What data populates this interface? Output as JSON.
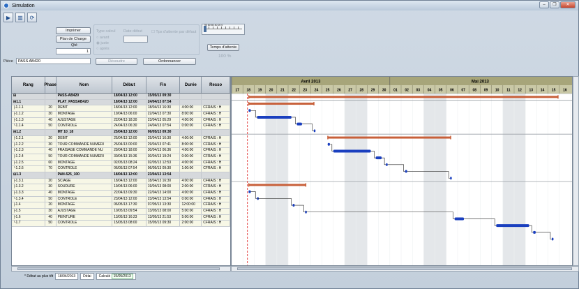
{
  "window": {
    "title": "Simulation",
    "controls": [
      "–",
      "❐",
      "✕"
    ]
  },
  "toolbar": [
    {
      "name": "play-icon",
      "glyph": "▶"
    },
    {
      "name": "chart-icon",
      "glyph": "▥"
    },
    {
      "name": "refresh-icon",
      "glyph": "⟳"
    }
  ],
  "form": {
    "imprimer": "Imprimer",
    "plan_de_charge": "Plan de Charge",
    "qte_label": "Qté",
    "qte_value": "1",
    "piece_label": "Pièce",
    "piece_value": "PASS AB420",
    "type_calcul": "Type calcul",
    "option_avant": "avant",
    "option_juste": "juste",
    "option_apres": "après",
    "date_label": "Date début",
    "tps_attente_defaut": "Tps d'attente par défaut",
    "temps_attente": "Temps d'attente",
    "slider_scale": "90 80 60 40 20 0",
    "percent": "100 %",
    "resoudre": "Résoudre",
    "ordonnancer": "Ordonnancer"
  },
  "table": {
    "headers": [
      "Rang",
      "Phase",
      "Nom",
      "Début",
      "Fin",
      "Durée",
      "Resso"
    ],
    "rows": [
      {
        "kind": "grp",
        "rang": "⊟",
        "phase": "",
        "nom": "PASS-AB420",
        "debut": "18/04/13 12:00",
        "fin": "15/05/13 09:30",
        "duree": "",
        "res": ""
      },
      {
        "kind": "grp",
        "rang": "⊟1.1",
        "phase": "",
        "nom": "PLAT_PASSAB420",
        "debut": "18/04/13 12:00",
        "fin": "24/04/13 07:54",
        "duree": "",
        "res": ""
      },
      {
        "kind": "task",
        "rang": "├1.1.1",
        "phase": "20",
        "nom": "DEBIT",
        "debut": "18/04/13 12:00",
        "fin": "18/04/13 16:30",
        "duree": "4:00:00",
        "res": "CFRAIS : H"
      },
      {
        "kind": "task",
        "rang": "├1.1.2",
        "phase": "30",
        "nom": "MONTAGE",
        "debut": "19/04/13 06:00",
        "fin": "22/04/13 07:30",
        "duree": "8:00:00",
        "res": "CFRAIS : H"
      },
      {
        "kind": "task",
        "rang": "├1.1.3",
        "phase": "40",
        "nom": "AJUSTAGE",
        "debut": "22/04/13 18:30",
        "fin": "23/04/13 05:29",
        "duree": "4:00:00",
        "res": "CFRAIS : H"
      },
      {
        "kind": "task",
        "rang": "└1.1.4",
        "phase": "50",
        "nom": "CONTROLE",
        "debut": "24/04/13 06:30",
        "fin": "24/04/13 07:54",
        "duree": "0:00:00",
        "res": "CFRAIS : H"
      },
      {
        "kind": "grp",
        "rang": "⊟1.2",
        "phase": "",
        "nom": "MT 10_18",
        "debut": "25/04/13 12:00",
        "fin": "06/05/13 09:30",
        "duree": "",
        "res": ""
      },
      {
        "kind": "task",
        "rang": "├1.2.1",
        "phase": "20",
        "nom": "DEBIT",
        "debut": "25/04/13 12:00",
        "fin": "25/04/13 16:30",
        "duree": "4:00:00",
        "res": "CFRAIS : H"
      },
      {
        "kind": "task",
        "rang": "├1.2.2",
        "phase": "30",
        "nom": "TOUR COMMANDE NUMERI",
        "debut": "26/04/13 00:00",
        "fin": "29/04/13 07:41",
        "duree": "8:00:00",
        "res": "CFRAIS : H"
      },
      {
        "kind": "task",
        "rang": "├1.2.3",
        "phase": "40",
        "nom": "FRAISAGE COMMANDE NU",
        "debut": "29/04/13 18:00",
        "fin": "30/04/13 06:36",
        "duree": "4:00:00",
        "res": "CFRAIS : H"
      },
      {
        "kind": "task",
        "rang": "├1.2.4",
        "phase": "50",
        "nom": "TOUR COMMANDE NUMERI",
        "debut": "30/04/13 15:36",
        "fin": "30/04/13 19:24",
        "duree": "0:00:00",
        "res": "CFRAIS : H"
      },
      {
        "kind": "task",
        "rang": "├1.2.5",
        "phase": "60",
        "nom": "MONTAGE",
        "debut": "02/05/13 08:24",
        "fin": "02/05/13 12:53",
        "duree": "4:00:00",
        "res": "CFRAIS : H"
      },
      {
        "kind": "task",
        "rang": "└1.2.6",
        "phase": "70",
        "nom": "CONTROLE",
        "debut": "06/05/13 07:54",
        "fin": "06/05/13 09:30",
        "duree": "1:00:00",
        "res": "CFRAIS : H"
      },
      {
        "kind": "grp",
        "rang": "⊟1.3",
        "phase": "",
        "nom": "PAN-525_100",
        "debut": "18/04/13 12:00",
        "fin": "23/04/13 13:54",
        "duree": "",
        "res": ""
      },
      {
        "kind": "task",
        "rang": "├1.3.1",
        "phase": "20",
        "nom": "SCIAGE",
        "debut": "18/04/13 12:00",
        "fin": "18/04/13 16:30",
        "duree": "4:00:00",
        "res": "CFRAIS : H"
      },
      {
        "kind": "task",
        "rang": "├1.3.2",
        "phase": "30",
        "nom": "SOUDURE",
        "debut": "19/04/13 06:00",
        "fin": "19/04/13 08:00",
        "duree": "2:00:00",
        "res": "CFRAIS : H"
      },
      {
        "kind": "task",
        "rang": "├1.3.3",
        "phase": "40",
        "nom": "MONTAGE",
        "debut": "22/04/13 09:30",
        "fin": "22/04/13 14:00",
        "duree": "4:00:00",
        "res": "CFRAIS : H"
      },
      {
        "kind": "task",
        "rang": "└1.3.4",
        "phase": "50",
        "nom": "CONTROLE",
        "debut": "23/04/13 12:00",
        "fin": "23/04/13 13:54",
        "duree": "0:00:00",
        "res": "CFRAIS : H"
      },
      {
        "kind": "task",
        "rang": "├1.4",
        "phase": "20",
        "nom": "MONTAGE",
        "debut": "06/05/13 17:30",
        "fin": "07/05/13 13:30",
        "duree": "12:00:00",
        "res": "CFRAIS : H"
      },
      {
        "kind": "task",
        "rang": "├1.5",
        "phase": "30",
        "nom": "AJUSTAGE",
        "debut": "10/05/13 09:54",
        "fin": "13/05/13 08:00",
        "duree": "5:00:00",
        "res": "CFRAIS : H"
      },
      {
        "kind": "task",
        "rang": "├1.6",
        "phase": "40",
        "nom": "PEINTURE",
        "debut": "13/05/13 16:23",
        "fin": "13/05/13 21:53",
        "duree": "5:00:00",
        "res": "CFRAIS : H"
      },
      {
        "kind": "task",
        "rang": "└1.7",
        "phase": "50",
        "nom": "CONTROLE",
        "debut": "15/05/13 08:00",
        "fin": "15/05/13 09:30",
        "duree": "2:00:00",
        "res": "CFRAIS : H"
      }
    ]
  },
  "gantt": {
    "months": [
      {
        "label": "Avril 2013",
        "start": 17,
        "end": 31
      },
      {
        "label": "Mai 2013",
        "start": 31,
        "end": 47
      }
    ],
    "days": [
      "17",
      "18",
      "19",
      "20",
      "21",
      "22",
      "23",
      "24",
      "25",
      "26",
      "27",
      "28",
      "29",
      "30",
      "01",
      "02",
      "03",
      "04",
      "05",
      "06",
      "07",
      "08",
      "09",
      "10",
      "11",
      "12",
      "13",
      "14",
      "15",
      "16"
    ],
    "today": 18.4,
    "colors": {
      "summary": "#c8603a",
      "task": "#1a3fbf",
      "link": "#222222",
      "today": "#e03030",
      "weekend": "#e4e7ea",
      "header": "#a7a57a"
    },
    "bars": [
      {
        "row": 0,
        "type": "summary",
        "start": 18.5,
        "end": 45.9
      },
      {
        "row": 1,
        "type": "summary",
        "start": 18.5,
        "end": 24.3
      },
      {
        "row": 2,
        "type": "task",
        "start": 18.5,
        "end": 18.7
      },
      {
        "row": 3,
        "type": "task",
        "start": 19.25,
        "end": 22.3
      },
      {
        "row": 4,
        "type": "task",
        "start": 22.77,
        "end": 23.23
      },
      {
        "row": 5,
        "type": "task",
        "start": 24.27,
        "end": 24.33
      },
      {
        "row": 6,
        "type": "summary",
        "start": 25.5,
        "end": 36.4
      },
      {
        "row": 7,
        "type": "task",
        "start": 25.5,
        "end": 25.7
      },
      {
        "row": 8,
        "type": "task",
        "start": 26.0,
        "end": 29.32
      },
      {
        "row": 9,
        "type": "task",
        "start": 29.75,
        "end": 30.28
      },
      {
        "row": 10,
        "type": "task",
        "start": 30.65,
        "end": 30.81
      },
      {
        "row": 11,
        "type": "task",
        "start": 32.35,
        "end": 32.54
      },
      {
        "row": 12,
        "type": "task",
        "start": 36.33,
        "end": 36.4
      },
      {
        "row": 13,
        "type": "summary",
        "start": 18.5,
        "end": 23.58
      },
      {
        "row": 14,
        "type": "task",
        "start": 18.5,
        "end": 18.7
      },
      {
        "row": 15,
        "type": "task",
        "start": 19.25,
        "end": 19.33
      },
      {
        "row": 16,
        "type": "task",
        "start": 22.4,
        "end": 22.58
      },
      {
        "row": 17,
        "type": "task",
        "start": 23.5,
        "end": 23.58
      },
      {
        "row": 18,
        "type": "task",
        "start": 36.73,
        "end": 37.56
      },
      {
        "row": 19,
        "type": "task",
        "start": 40.41,
        "end": 43.33
      },
      {
        "row": 20,
        "type": "task",
        "start": 43.68,
        "end": 43.91
      },
      {
        "row": 21,
        "type": "task",
        "start": 45.33,
        "end": 45.4
      }
    ]
  },
  "status": {
    "debut_label": "* Début au plus tôt",
    "debut_value": "18/04/2013",
    "delai_label": "Délai",
    "calcule_label": "Calculé",
    "calcule_value": "15/05/2013"
  }
}
